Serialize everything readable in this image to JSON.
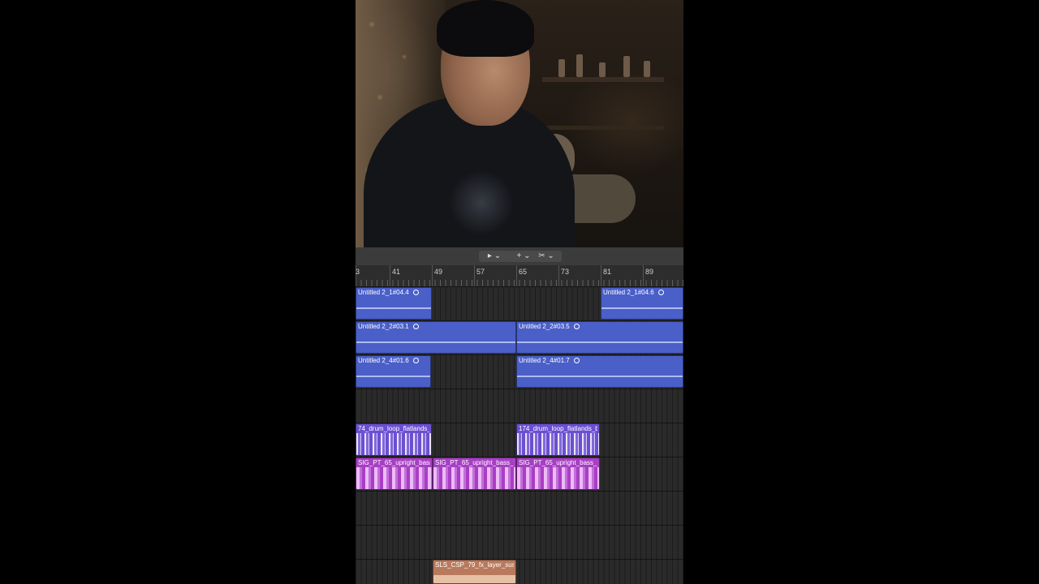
{
  "toolbar": {
    "pointer_tool": "▸ ⌄",
    "pencil_tool": "+ ⌄",
    "scissors_tool": "✂ ⌄"
  },
  "ruler": {
    "bars": [
      "3",
      "41",
      "49",
      "57",
      "65",
      "73",
      "81",
      "89"
    ]
  },
  "regions": [
    {
      "label": "Untitled 2_1#04.4",
      "color": "blue"
    },
    {
      "label": "Untitled 2_1#04.6",
      "color": "blue"
    },
    {
      "label": "Untitled 2_2#03.1",
      "color": "blue"
    },
    {
      "label": "Untitled 2_2#03.5",
      "color": "blue"
    },
    {
      "label": "Untitled 2_4#01.6",
      "color": "blue"
    },
    {
      "label": "Untitled 2_4#01.7",
      "color": "blue"
    },
    {
      "label": "74_drum_loop_flatlands_br",
      "color": "purple"
    },
    {
      "label": "174_drum_loop_flatlands_br",
      "color": "purple"
    },
    {
      "label": "SIG_PT_65_upright_bass_t",
      "color": "magenta"
    },
    {
      "label": "SIG_PT_65_upright_bass_t",
      "color": "magenta"
    },
    {
      "label": "SIG_PT_65_upright_bass_t",
      "color": "magenta"
    },
    {
      "label": "SLS_CSP_79_fx_layer_susta",
      "color": "orange"
    }
  ],
  "colors": {
    "blue_region": "#4a5fc8",
    "purple_region": "#6b4fd2",
    "magenta_region": "#a73fc4",
    "orange_region": "#b9795c"
  }
}
